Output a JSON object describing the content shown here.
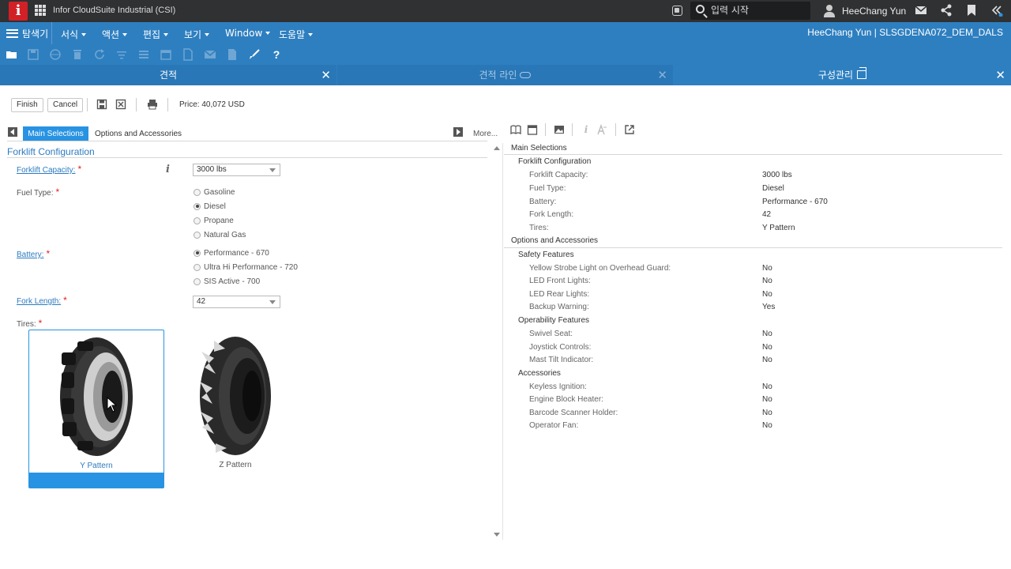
{
  "app": {
    "logo_letter": "i",
    "title": "Infor CloudSuite Industrial (CSI)",
    "search_placeholder": "입력 시작",
    "user_name": "HeeChang Yun"
  },
  "menubar": {
    "explorer": "탐색기",
    "menus": [
      "서식",
      "액션",
      "편집",
      "보기",
      "Window",
      "도움말"
    ],
    "session": "HeeChang Yun | SLSGDENA072_DEM_DALS"
  },
  "tabs": [
    {
      "label": "견적"
    },
    {
      "label": "견적 라인"
    },
    {
      "label": "구성관리"
    }
  ],
  "actions": {
    "finish": "Finish",
    "cancel": "Cancel",
    "price_label": "Price:",
    "price_value": "40,072 USD"
  },
  "left": {
    "tab_main": "Main Selections",
    "tab_options": "Options and Accessories",
    "more": "More...",
    "section_title": "Forklift Configuration",
    "capacity_label": "Forklift Capacity:",
    "capacity_value": "3000 lbs",
    "fuel_label": "Fuel Type:",
    "fuel_options": [
      "Gasoline",
      "Diesel",
      "Propane",
      "Natural Gas"
    ],
    "fuel_selected": "Diesel",
    "battery_label": "Battery:",
    "battery_options": [
      "Performance - 670",
      "Ultra Hi Performance - 720",
      "SIS Active - 700"
    ],
    "battery_selected": "Performance - 670",
    "fork_label": "Fork Length:",
    "fork_value": "42",
    "tires_label": "Tires:",
    "tires": [
      {
        "label": "Y Pattern",
        "selected": true
      },
      {
        "label": "Z Pattern",
        "selected": false
      }
    ],
    "required_mark": "*"
  },
  "summary": {
    "main_title": "Main Selections",
    "config_title": "Forklift Configuration",
    "config_rows": [
      {
        "k": "Forklift Capacity:",
        "v": "3000 lbs"
      },
      {
        "k": "Fuel Type:",
        "v": "Diesel"
      },
      {
        "k": "Battery:",
        "v": "Performance - 670"
      },
      {
        "k": "Fork Length:",
        "v": "42"
      },
      {
        "k": "Tires:",
        "v": "Y Pattern"
      }
    ],
    "options_title": "Options and Accessories",
    "safety_title": "Safety Features",
    "safety_rows": [
      {
        "k": "Yellow Strobe Light on Overhead Guard:",
        "v": "No"
      },
      {
        "k": "LED Front Lights:",
        "v": "No"
      },
      {
        "k": "LED Rear Lights:",
        "v": "No"
      },
      {
        "k": "Backup Warning:",
        "v": "Yes"
      }
    ],
    "operability_title": "Operability Features",
    "operability_rows": [
      {
        "k": "Swivel Seat:",
        "v": "No"
      },
      {
        "k": "Joystick Controls:",
        "v": "No"
      },
      {
        "k": "Mast Tilt Indicator:",
        "v": "No"
      }
    ],
    "accessories_title": "Accessories",
    "accessories_rows": [
      {
        "k": "Keyless Ignition:",
        "v": "No"
      },
      {
        "k": "Engine Block Heater:",
        "v": "No"
      },
      {
        "k": "Barcode Scanner Holder:",
        "v": "No"
      },
      {
        "k": "Operator Fan:",
        "v": "No"
      }
    ]
  },
  "colors": {
    "menubar_blue": "#2e7fc0",
    "accent_blue": "#2893e2",
    "logo_red": "#d22027",
    "required_red": "#e2202b",
    "topbar_dark": "#303133"
  }
}
